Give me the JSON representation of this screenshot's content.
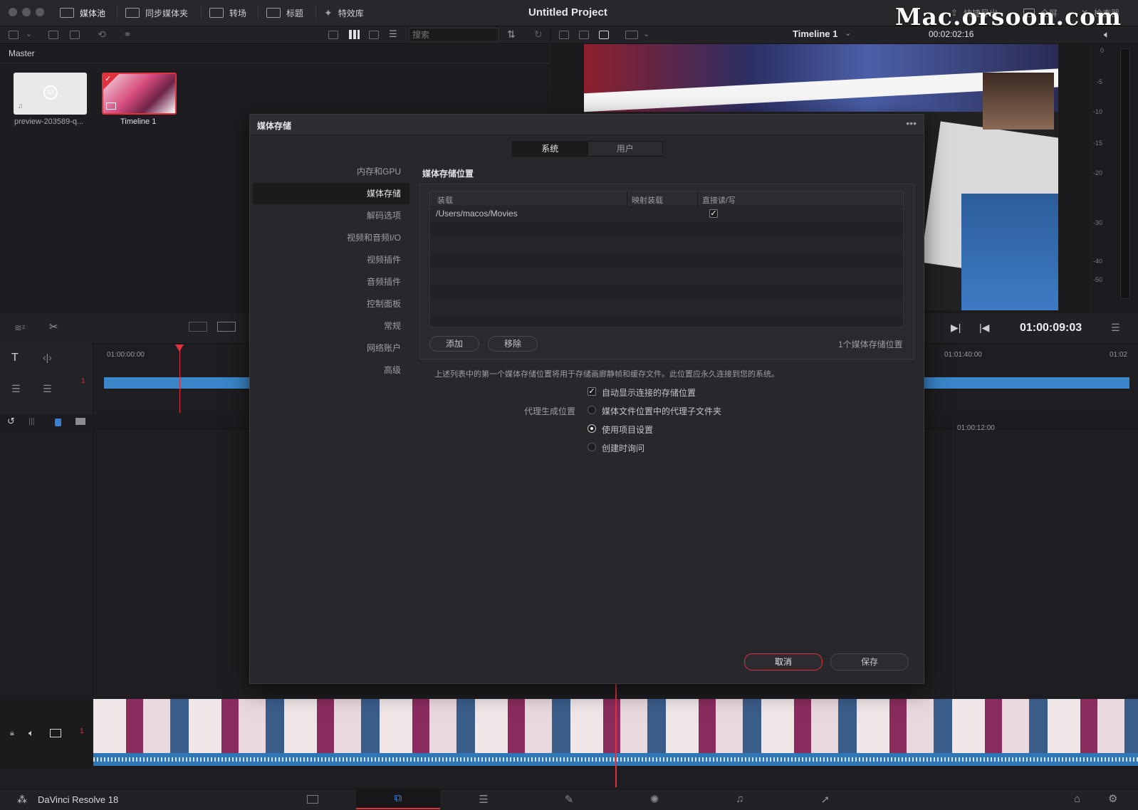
{
  "toolbar": {
    "media_pool": "媒体池",
    "sync_bin": "同步媒体夹",
    "transitions": "转场",
    "titles": "标题",
    "effects": "特效库",
    "project_title": "Untitled Project",
    "quick_export": "快捷导出",
    "fullscreen": "全屏",
    "inspector": "检查器",
    "watermark": "Mac.orsoon.com"
  },
  "secondary": {
    "search_placeholder": "搜索",
    "timeline_name": "Timeline 1",
    "duration": "00:02:02:16"
  },
  "media_pool": {
    "bin_name": "Master",
    "clips": [
      {
        "name": "preview-203589-q..."
      },
      {
        "name": "Timeline 1"
      }
    ]
  },
  "viewer": {
    "timecode": "01:00:09:03",
    "meter_ticks": [
      "0",
      "-5",
      "-10",
      "-15",
      "-20",
      "-30",
      "-40",
      "-50"
    ]
  },
  "timeline": {
    "ruler_start": "01:00:00:00",
    "ruler_right1": "01:01:40:00",
    "ruler_right2": "01:02",
    "ruler_lower": "01:00:12:00",
    "track_num": "1"
  },
  "dialog": {
    "title": "媒体存储",
    "tabs": [
      "系统",
      "用户"
    ],
    "nav": [
      "内存和GPU",
      "媒体存储",
      "解码选项",
      "视频和音频I/O",
      "视频插件",
      "音频插件",
      "控制面板",
      "常规",
      "网络账户",
      "高级"
    ],
    "section_title": "媒体存储位置",
    "table": {
      "headers": [
        "装载",
        "映射装载",
        "直接读/写"
      ],
      "rows": [
        {
          "path": "/Users/macos/Movies",
          "direct": "✓"
        }
      ]
    },
    "add": "添加",
    "remove": "移除",
    "count": "1个媒体存储位置",
    "note": "上述列表中的第一个媒体存储位置将用于存储画廊静帧和缓存文件。此位置应永久连接到您的系统。",
    "auto_show": "自动显示连接的存储位置",
    "proxy_label": "代理生成位置",
    "proxy_options": [
      "媒体文件位置中的代理子文件夹",
      "使用项目设置",
      "创建时询问"
    ],
    "cancel": "取消",
    "save": "保存"
  },
  "footer": {
    "app_name": "DaVinci Resolve 18"
  }
}
